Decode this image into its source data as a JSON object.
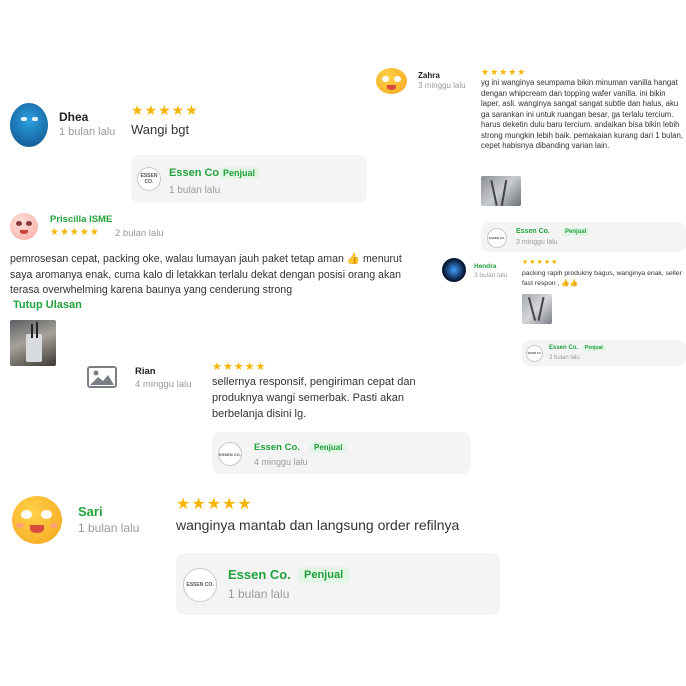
{
  "colors": {
    "accent": "#22a33c",
    "star": "#f7b500",
    "badge_bg": "#e3f6e6",
    "card_bg": "#f4f4f4"
  },
  "seller": {
    "name": "Essen Co.",
    "badge": "Penjual",
    "logo_text": "ESSEN CO."
  },
  "reviews": {
    "dhea": {
      "name": "Dhea",
      "time": "1 bulan lalu",
      "stars": "★★★★★",
      "text": "Wangi bgt",
      "seller_time": "1 bulan lalu"
    },
    "zahra": {
      "name": "Zahra",
      "time": "3 minggu lalu",
      "stars": "★★★★★",
      "text": "yg ini wanginya seumpama bikin minuman vanilla hangat dengan whipcream dan topping wafer vanilla. ini bikin laper, asli. wanginya sangat sangat subtle dan halus, aku ga sarankan ini untuk ruangan besar, ga terlalu tercium. harus deketin dulu baru tercium. andaikan bisa bikin lebih strong mungkin lebih baik. pemakaian kurang dari 1 bulan, cepet habisnya dibanding varian lain.",
      "seller_time": "3 minggu lalu"
    },
    "priscilla": {
      "name": "Priscilla ISME",
      "time": "2 bulan lalu",
      "stars": "★★★★★",
      "text": "pemrosesan cepat, packing oke, walau lumayan jauh paket tetap aman 👍 menurut saya aromanya enak, cuma kalo di letakkan terlalu dekat dengan posisi orang akan terasa overwhelming karena baunya yang cenderung strong",
      "toggle": "Tutup Ulasan"
    },
    "hendra": {
      "name": "Hendra",
      "time": "3 bulan lalu",
      "stars": "★★★★★",
      "text": "packing rapih produkny bagus, wanginya enak, seller fast respon , 👍👍",
      "seller_time": "3 bulan lalu"
    },
    "rian": {
      "name": "Rian",
      "time": "4 minggu lalu",
      "stars": "★★★★★",
      "text": "sellernya responsif, pengiriman cepat dan produknya wangi semerbak. Pasti akan berbelanja disini lg.",
      "seller_time": "4 minggu lalu"
    },
    "sari": {
      "name": "Sari",
      "time": "1 bulan lalu",
      "stars": "★★★★★",
      "text": "wanginya mantab dan langsung order refilnya",
      "seller_time": "1 bulan lalu"
    }
  }
}
